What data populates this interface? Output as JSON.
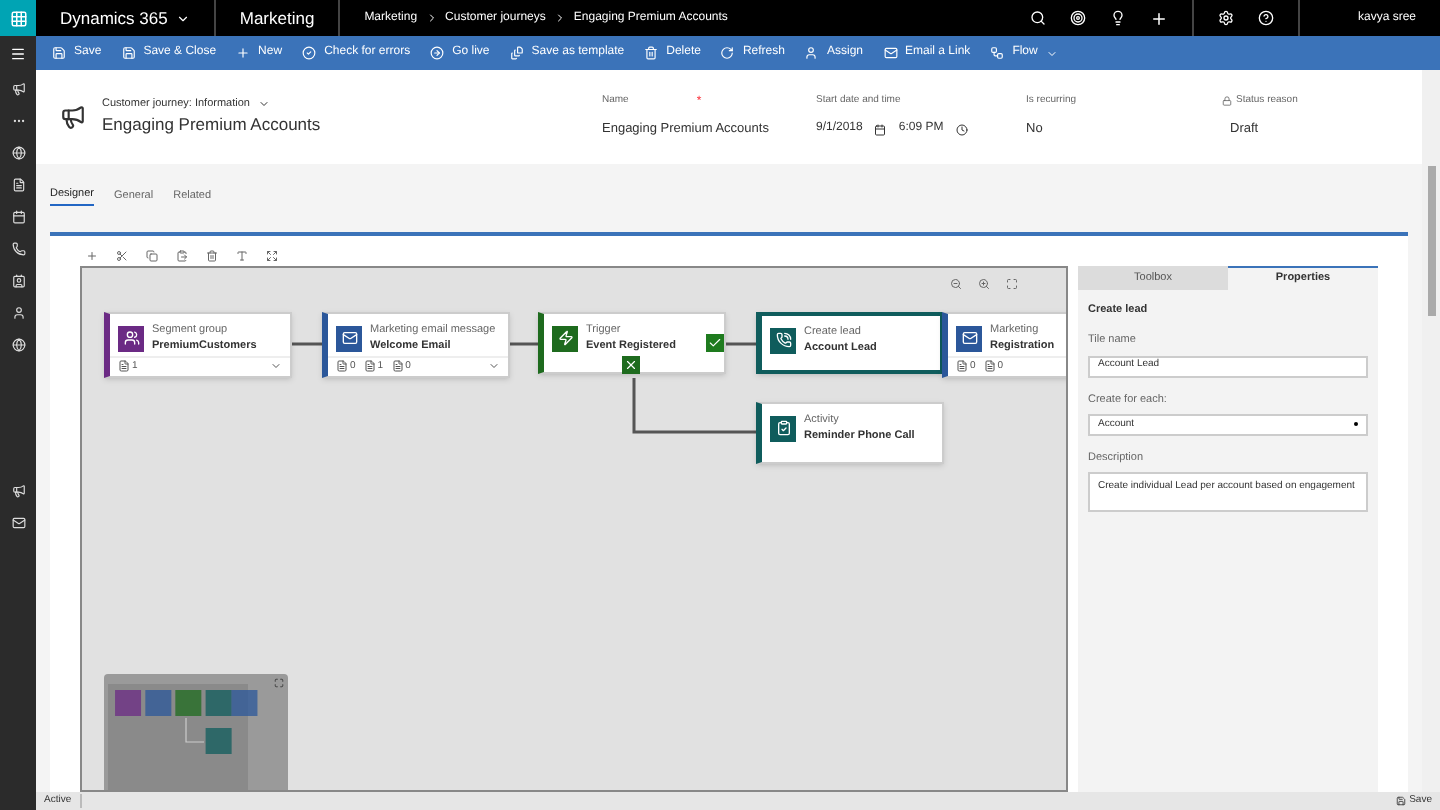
{
  "top_bar": {
    "app": "Dynamics 365",
    "area": "Marketing",
    "breadcrumb": [
      "Marketing",
      "Customer journeys",
      "Engaging Premium Accounts"
    ],
    "user": "kavya sree"
  },
  "commands": [
    {
      "label": "Save"
    },
    {
      "label": "Save & Close"
    },
    {
      "label": "New"
    },
    {
      "label": "Check for errors"
    },
    {
      "label": "Go live"
    },
    {
      "label": "Save as template"
    },
    {
      "label": "Delete"
    },
    {
      "label": "Refresh"
    },
    {
      "label": "Assign"
    },
    {
      "label": "Email a Link"
    },
    {
      "label": "Flow",
      "menu": true
    }
  ],
  "header": {
    "form": "Customer journey: Information",
    "title": "Engaging Premium Accounts",
    "fields": [
      {
        "kind": "name",
        "label": "Name",
        "required_mark": "*",
        "value": "Engaging Premium Accounts"
      },
      {
        "kind": "datetime",
        "label": "Start date and time",
        "date": "9/1/2018",
        "time": "6:09 PM"
      },
      {
        "kind": "text",
        "label": "Is recurring",
        "value": "No"
      },
      {
        "kind": "locked",
        "label": "Status reason",
        "value": "Draft"
      }
    ]
  },
  "tabs": [
    {
      "label": "Designer",
      "selected": true
    },
    {
      "label": "General",
      "selected": false
    },
    {
      "label": "Related",
      "selected": false
    }
  ],
  "nodes": [
    {
      "kind": "segment",
      "type": "Segment group",
      "name": "PremiumCustomers",
      "color": "#6b2a84",
      "selected": false,
      "counts": [
        "1"
      ]
    },
    {
      "kind": "email",
      "type": "Marketing email message",
      "name": "Welcome Email",
      "color": "#2b579a",
      "selected": false,
      "counts": [
        "0",
        "1",
        "0"
      ]
    },
    {
      "kind": "trigger",
      "type": "Trigger",
      "name": "Event Registered",
      "color": "#1e6b1e",
      "selected": false
    },
    {
      "kind": "lead",
      "type": "Create lead",
      "name": "Account Lead",
      "color": "#0f5c5c",
      "selected": true
    },
    {
      "kind": "email2",
      "type": "Marketing",
      "name": "Registration",
      "color": "#2b579a",
      "selected": false,
      "counts": [
        "0",
        "0"
      ]
    },
    {
      "kind": "activity",
      "type": "Activity",
      "name": "Reminder Phone Call",
      "color": "#0f5c5c",
      "selected": false
    }
  ],
  "panel": {
    "tabs": [
      {
        "label": "Toolbox",
        "selected": false
      },
      {
        "label": "Properties",
        "selected": true
      }
    ],
    "heading": "Create lead",
    "fields": [
      {
        "kind": "text",
        "label": "Tile name",
        "value": "Account Lead"
      },
      {
        "kind": "select",
        "label": "Create for each:",
        "value": "Account"
      },
      {
        "kind": "textarea",
        "label": "Description",
        "value": "Create individual Lead per account based on engagement"
      }
    ]
  },
  "status_bar": {
    "status": "Active",
    "save": "Save"
  }
}
